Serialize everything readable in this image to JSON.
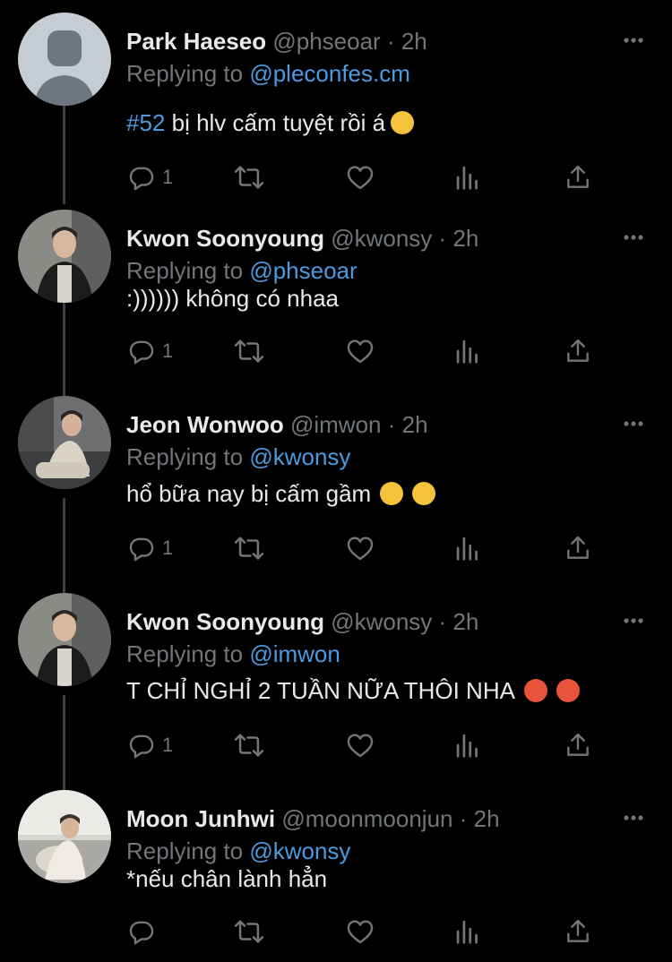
{
  "colors": {
    "background": "#000000",
    "text": "#e7e9ea",
    "muted": "#71767b",
    "link": "#4a9be0",
    "thread_line": "#3e4144"
  },
  "reply_prefix": "Replying to",
  "tweets": [
    {
      "name": "Park Haeseo",
      "handle": "@phseoar",
      "time": "2h",
      "reply_to": "@pleconfes.cm",
      "hashtag": "#52",
      "text": " bị hlv cấm tuyệt rồi á",
      "emojis": [
        "relieved-face-emoji"
      ],
      "reply_count": "1",
      "avatar": "default-avatar"
    },
    {
      "name": "Kwon Soonyoung",
      "handle": "@kwonsy",
      "time": "2h",
      "reply_to": "@phseoar",
      "text": ":)))))) không có nhaa",
      "emojis": [],
      "reply_count": "1",
      "avatar": "photo"
    },
    {
      "name": "Jeon Wonwoo",
      "handle": "@imwon",
      "time": "2h",
      "reply_to": "@kwonsy",
      "text": "hổ bữa nay bị cấm gầm",
      "emojis": [
        "kissing-face-emoji",
        "kissing-face-emoji"
      ],
      "reply_count": "1",
      "avatar": "photo"
    },
    {
      "name": "Kwon Soonyoung",
      "handle": "@kwonsy",
      "time": "2h",
      "reply_to": "@imwon",
      "text": "T CHỈ NGHỈ 2 TUẦN NỮA THÔI NHA",
      "emojis": [
        "angry-face-emoji",
        "angry-face-emoji"
      ],
      "reply_count": "1",
      "avatar": "photo"
    },
    {
      "name": "Moon Junhwi",
      "handle": "@moonmoonjun",
      "time": "2h",
      "reply_to": "@kwonsy",
      "text": "*nếu chân lành hẳn",
      "emojis": [],
      "reply_count": "",
      "avatar": "photo"
    }
  ],
  "action_icons": [
    "reply-icon",
    "retweet-icon",
    "like-icon",
    "analytics-icon",
    "share-icon"
  ]
}
